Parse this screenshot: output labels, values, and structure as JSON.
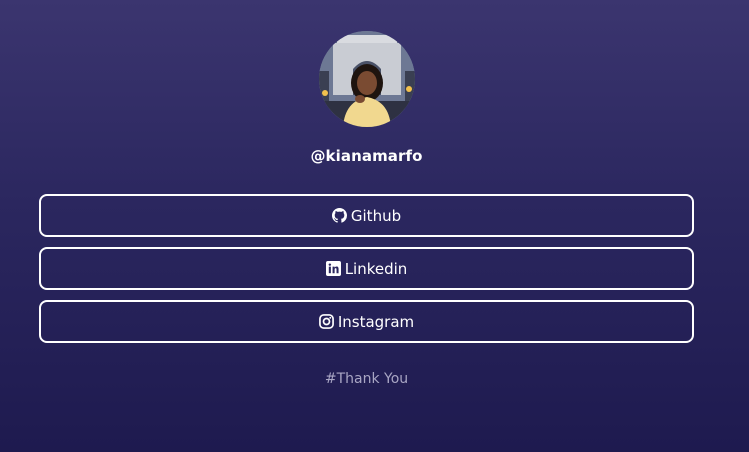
{
  "profile": {
    "handle": "@kianamarfo"
  },
  "links": [
    {
      "label": "Github",
      "icon": "github-icon"
    },
    {
      "label": "Linkedin",
      "icon": "linkedin-icon"
    },
    {
      "label": "Instagram",
      "icon": "instagram-icon"
    }
  ],
  "footer": {
    "text": "#Thank You"
  },
  "colors": {
    "background_top": "#3b356f",
    "background_bottom": "#1e1a4f",
    "button_border": "#ffffff",
    "footer_text": "#a9a6c4"
  }
}
